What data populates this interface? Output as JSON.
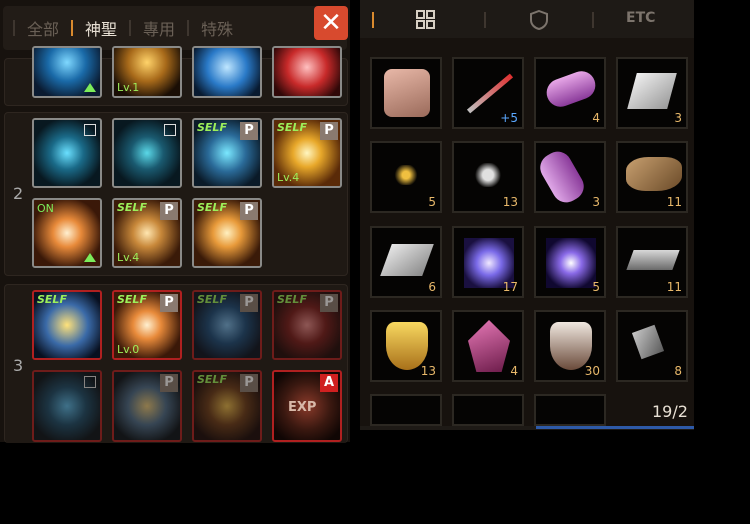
{
  "skill_panel": {
    "tabs": [
      {
        "label": "全部"
      },
      {
        "label": "神聖"
      },
      {
        "label": "專用"
      },
      {
        "label": "特殊"
      }
    ],
    "close_label": "✕",
    "group2_label": "2",
    "group3_label": "3",
    "top_lv": "Lv.1",
    "g2": {
      "s3_self": "SELF",
      "s3_p": "P",
      "s4_self": "SELF",
      "s4_p": "P",
      "s4_lv": "Lv.4",
      "s5_on": "ON",
      "s6_self": "SELF",
      "s6_p": "P",
      "s6_lv": "Lv.4",
      "s7_self": "SELF",
      "s7_p": "P"
    },
    "g3": {
      "s1_self": "SELF",
      "s2_self": "SELF",
      "s2_p": "P",
      "s2_lv": "Lv.0",
      "s3_self": "SELF",
      "s3_p": "P",
      "s4_self": "SELF",
      "s4_p": "P",
      "s6_p": "P",
      "s7_self": "SELF",
      "s7_p": "P",
      "s8_a": "A",
      "s8_text": "EXP"
    }
  },
  "inventory": {
    "etc_label": "ETC",
    "page_indicator": "19/2",
    "counts": {
      "r1c2": "+5",
      "r1c3": "4",
      "r1c4": "3",
      "r2c1": "5",
      "r2c2": "13",
      "r2c3": "3",
      "r2c4": "11",
      "r3c1": "6",
      "r3c2": "17",
      "r3c3": "5",
      "r3c4": "11",
      "r4c1": "13",
      "r4c2": "4",
      "r4c3": "30",
      "r4c4": "8"
    }
  }
}
